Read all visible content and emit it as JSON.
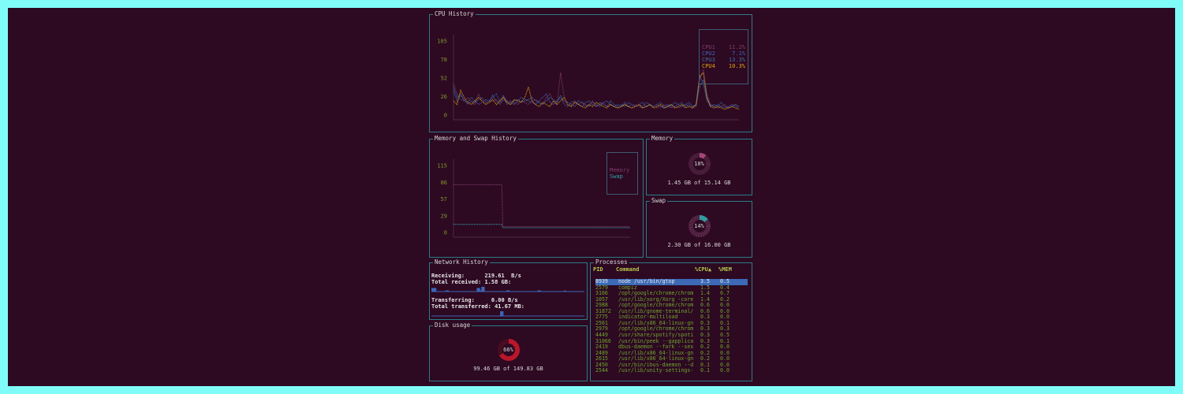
{
  "colors": {
    "background": "#2d0922",
    "border": "#2a7d86",
    "axis_text": "#7f9a2a",
    "cpu1": "#7f3f6e",
    "cpu2": "#3d66b8",
    "cpu3": "#3f6ea0",
    "cpu4": "#e0a40c",
    "memory": "#7f3f6e",
    "swap": "#2fa2a6",
    "disk": "#c0182a",
    "process_text": "#6fa62c",
    "process_header": "#b6c74b",
    "selection": "#3c6ab6"
  },
  "cpu_panel": {
    "title": "CPU History",
    "legend": [
      {
        "label": "CPU1",
        "value": "11.2%"
      },
      {
        "label": "CPU2",
        "value": "7.1%"
      },
      {
        "label": "CPU3",
        "value": "13.3%"
      },
      {
        "label": "CPU4",
        "value": "10.3%"
      }
    ]
  },
  "memswap_panel": {
    "title": "Memory and Swap History",
    "legend": [
      {
        "label": "Memory"
      },
      {
        "label": "Swap"
      }
    ]
  },
  "memory_panel": {
    "title": "Memory",
    "percent_label": "10%",
    "percent": 10,
    "usage": "1.45 GB of 15.14 GB"
  },
  "swap_panel": {
    "title": "Swap",
    "percent_label": "14%",
    "percent": 14,
    "usage": "2.30 GB of 16.00 GB"
  },
  "network_panel": {
    "title": "Network History",
    "receiving_label": "Receiving:",
    "receiving_value": "219.61  B/s",
    "total_received_label": "Total received:",
    "total_received_value": "1.58 GB:",
    "transferring_label": "Transferring:",
    "transferring_value": "0.00 B/s",
    "total_transferred_label": "Total transferred:",
    "total_transferred_value": "41.67 MB:",
    "rx_history": [
      3,
      3,
      3,
      0,
      0,
      0,
      0,
      0,
      0,
      1,
      1,
      0,
      0,
      0,
      0,
      0,
      0,
      0,
      0,
      0,
      0,
      0,
      0,
      0,
      0,
      0,
      0,
      0,
      0,
      3,
      3,
      1,
      4,
      4,
      0,
      0,
      0,
      0,
      0,
      0,
      0,
      0,
      0,
      0,
      0,
      0,
      0,
      0,
      1,
      1,
      0,
      0,
      0,
      0,
      0,
      0,
      0,
      0,
      0,
      0,
      0,
      0,
      0,
      0,
      0,
      0,
      0,
      0,
      1,
      1,
      0,
      0,
      0,
      0,
      0,
      0,
      0,
      0,
      0,
      0,
      0,
      0,
      0,
      0,
      0,
      1,
      0,
      0,
      0,
      0,
      0,
      0,
      0,
      0,
      0,
      0,
      0,
      0
    ],
    "tx_history": [
      0,
      0,
      0,
      0,
      0,
      0,
      0,
      0,
      0,
      0,
      0,
      0,
      0,
      0,
      0,
      0,
      0,
      0,
      0,
      0,
      0,
      0,
      0,
      0,
      0,
      0,
      0,
      0,
      0,
      0,
      0,
      0,
      0,
      0,
      0,
      0,
      0,
      0,
      0,
      0,
      0,
      0,
      0,
      0,
      4,
      4,
      0,
      0,
      0,
      0,
      0,
      0,
      0,
      0,
      0,
      0,
      0,
      0,
      0,
      0,
      0,
      0,
      0,
      0,
      0,
      0,
      0,
      0,
      0,
      0,
      0,
      0,
      0,
      0,
      0,
      0,
      0,
      0,
      0,
      0,
      0,
      0,
      0,
      0,
      0,
      0,
      0,
      0,
      0,
      0,
      0,
      0,
      0,
      0,
      0,
      0,
      0,
      0
    ]
  },
  "disk_panel": {
    "title": "Disk usage",
    "percent_label": "66%",
    "percent": 66,
    "usage": "99.46 GB of 149.83 GB"
  },
  "process_panel": {
    "title": "Processes",
    "headers": {
      "pid": "PID",
      "command": "Command",
      "cpu": "%CPU▲",
      "mem": "%MEM"
    },
    "rows": [
      {
        "pid": "8939",
        "command": "node /usr/bin/gtop",
        "cpu": "3.5",
        "mem": "0.5"
      },
      {
        "pid": "2579",
        "command": "compiz",
        "cpu": "1.5",
        "mem": "0.4"
      },
      {
        "pid": "3166",
        "command": "/opt/google/chrome/chrom",
        "cpu": "1.4",
        "mem": "0.7"
      },
      {
        "pid": "1057",
        "command": "/usr/lib/xorg/Xorg -core",
        "cpu": "1.4",
        "mem": "0.2"
      },
      {
        "pid": "2988",
        "command": "/opt/google/chrome/chrom",
        "cpu": "0.6",
        "mem": "0.0"
      },
      {
        "pid": "31872",
        "command": "/usr/lib/gnome-terminal/",
        "cpu": "0.6",
        "mem": "0.0"
      },
      {
        "pid": "2775",
        "command": "indicator-multiload",
        "cpu": "0.3",
        "mem": "0.0"
      },
      {
        "pid": "2561",
        "command": "/usr/lib/x86_64-linux-gn",
        "cpu": "0.3",
        "mem": "0.1"
      },
      {
        "pid": "2979",
        "command": "/opt/google/chrome/chrom",
        "cpu": "0.3",
        "mem": "0.3"
      },
      {
        "pid": "4449",
        "command": "/usr/share/spotify/spoti",
        "cpu": "0.3",
        "mem": "0.5"
      },
      {
        "pid": "31066",
        "command": "/usr/bin/peek --gapplica",
        "cpu": "0.3",
        "mem": "0.1"
      },
      {
        "pid": "2419",
        "command": "dbus-daemon --fork --ses",
        "cpu": "0.2",
        "mem": "0.0"
      },
      {
        "pid": "2489",
        "command": "/usr/lib/x86_64-linux-gn",
        "cpu": "0.2",
        "mem": "0.0"
      },
      {
        "pid": "2615",
        "command": "/usr/lib/x86_64-linux-gn",
        "cpu": "0.2",
        "mem": "0.0"
      },
      {
        "pid": "2450",
        "command": "/usr/bin/ibus-daemon --d",
        "cpu": "0.1",
        "mem": "0.0"
      },
      {
        "pid": "2544",
        "command": "/usr/lib/unity-settings-",
        "cpu": "0.1",
        "mem": "0.0"
      }
    ]
  },
  "chart_data": [
    {
      "type": "line",
      "ylim": [
        0,
        105
      ],
      "y_ticks": [
        "105",
        "78",
        "52",
        "26",
        "0"
      ],
      "series": [
        {
          "name": "CPU1",
          "values": [
            45,
            30,
            22,
            20,
            25,
            18,
            15,
            30,
            20,
            15,
            18,
            20,
            22,
            18,
            25,
            15,
            20,
            18,
            15,
            20,
            18,
            15,
            20,
            22,
            18,
            15,
            25,
            30,
            20,
            15,
            60,
            25,
            15,
            12,
            20,
            15,
            18,
            12,
            15,
            20,
            12,
            15,
            18,
            12,
            15,
            12,
            10,
            12,
            15,
            12,
            10,
            15,
            12,
            10,
            12,
            15,
            12,
            10,
            12,
            15,
            12,
            10,
            12,
            10,
            12,
            15,
            12,
            10,
            12,
            50,
            65,
            30,
            15,
            12,
            10,
            12,
            15,
            10,
            12,
            15,
            12
          ]
        },
        {
          "name": "CPU2",
          "values": [
            40,
            25,
            30,
            20,
            18,
            25,
            20,
            15,
            18,
            22,
            20,
            25,
            30,
            20,
            28,
            20,
            18,
            15,
            20,
            25,
            22,
            20,
            18,
            15,
            20,
            25,
            30,
            18,
            15,
            20,
            25,
            20,
            18,
            15,
            12,
            20,
            18,
            15,
            12,
            18,
            15,
            12,
            18,
            20,
            15,
            12,
            15,
            12,
            18,
            12,
            15,
            12,
            15,
            12,
            18,
            15,
            12,
            15,
            12,
            10,
            12,
            15,
            12,
            15,
            18,
            12,
            15,
            12,
            15,
            55,
            45,
            20,
            15,
            12,
            15,
            12,
            10,
            12,
            15,
            12,
            10
          ]
        },
        {
          "name": "CPU3",
          "values": [
            35,
            20,
            28,
            22,
            15,
            20,
            18,
            22,
            25,
            18,
            20,
            28,
            20,
            15,
            22,
            18,
            15,
            20,
            22,
            18,
            20,
            22,
            25,
            20,
            18,
            15,
            20,
            25,
            22,
            18,
            28,
            15,
            12,
            18,
            20,
            15,
            12,
            18,
            20,
            15,
            12,
            18,
            15,
            12,
            20,
            15,
            12,
            15,
            12,
            18,
            15,
            12,
            15,
            18,
            12,
            15,
            12,
            15,
            18,
            12,
            15,
            12,
            18,
            15,
            12,
            15,
            18,
            12,
            15,
            40,
            50,
            25,
            12,
            15,
            12,
            18,
            12,
            10,
            12,
            15,
            12
          ]
        },
        {
          "name": "CPU4",
          "values": [
            20,
            15,
            35,
            25,
            18,
            15,
            20,
            25,
            20,
            15,
            18,
            22,
            15,
            20,
            25,
            18,
            15,
            22,
            20,
            18,
            25,
            40,
            20,
            15,
            12,
            18,
            15,
            12,
            20,
            15,
            20,
            25,
            15,
            12,
            18,
            15,
            12,
            10,
            15,
            12,
            18,
            15,
            12,
            10,
            15,
            12,
            10,
            12,
            15,
            12,
            10,
            12,
            15,
            10,
            12,
            15,
            10,
            12,
            15,
            10,
            12,
            15,
            10,
            12,
            15,
            10,
            12,
            10,
            15,
            55,
            60,
            25,
            12,
            10,
            12,
            10,
            8,
            10,
            12,
            10,
            8
          ]
        }
      ]
    },
    {
      "type": "line",
      "ylim": [
        0,
        115
      ],
      "y_ticks": [
        "115",
        "86",
        "57",
        "29",
        "0"
      ],
      "series": [
        {
          "name": "Memory",
          "values": [
            82,
            82,
            82,
            82,
            82,
            82,
            82,
            82,
            82,
            82,
            82,
            82,
            82,
            82,
            82,
            82,
            82,
            82,
            82,
            82,
            82,
            82,
            82,
            82,
            82,
            82,
            82,
            82,
            82,
            82,
            82,
            82,
            82,
            82,
            82,
            82,
            82,
            82,
            82,
            82,
            82,
            82,
            82,
            82,
            82,
            82,
            82,
            82,
            82,
            82,
            10,
            10,
            10,
            10,
            10,
            10,
            10,
            10,
            10,
            10,
            10,
            10,
            10,
            10,
            10,
            10,
            10,
            10,
            10,
            10,
            10,
            10,
            10,
            10,
            10,
            10,
            10,
            10,
            10,
            10,
            10,
            10,
            10,
            10,
            10,
            10,
            10,
            10,
            10,
            10,
            10,
            10,
            10,
            10,
            10,
            10,
            10,
            10,
            10,
            10,
            10,
            10,
            10,
            10,
            10,
            10,
            10,
            10,
            10,
            10,
            10,
            10,
            10,
            10,
            10,
            10,
            10,
            10,
            10,
            10,
            10,
            10,
            10,
            10,
            10,
            10,
            10,
            10,
            10,
            10,
            10,
            10,
            10,
            10,
            10,
            10,
            10,
            10,
            10,
            10,
            10,
            10,
            10,
            10,
            10,
            10,
            10,
            10,
            10,
            10,
            10,
            10,
            10,
            10,
            10,
            10,
            10,
            10,
            10,
            10,
            10,
            10,
            10,
            10,
            10,
            10,
            10,
            10,
            10,
            10,
            10,
            10,
            10,
            10,
            10,
            10,
            10,
            10,
            10,
            10
          ]
        },
        {
          "name": "Swap",
          "values": [
            14,
            14,
            14,
            14,
            14,
            14,
            14,
            14,
            14,
            14,
            14,
            14,
            14,
            14,
            14,
            14,
            14,
            14,
            14,
            14,
            14,
            14,
            14,
            14,
            14,
            14,
            14,
            14,
            14,
            14,
            14,
            14,
            14,
            14,
            14,
            14,
            14,
            14,
            14,
            14,
            14,
            14,
            14,
            14,
            14,
            14,
            14,
            14,
            14,
            14,
            8,
            8,
            8,
            8,
            8,
            8,
            8,
            8,
            8,
            8,
            8,
            8,
            8,
            8,
            8,
            8,
            8,
            8,
            8,
            8,
            8,
            8,
            8,
            8,
            8,
            8,
            8,
            8,
            8,
            8,
            8,
            8,
            8,
            8,
            8,
            8,
            8,
            8,
            8,
            8,
            8,
            8,
            8,
            8,
            8,
            8,
            8,
            8,
            8,
            8,
            8,
            8,
            8,
            8,
            8,
            8,
            8,
            8,
            8,
            8,
            8,
            8,
            8,
            8,
            8,
            8,
            8,
            8,
            8,
            8,
            8,
            8,
            8,
            8,
            8,
            8,
            8,
            8,
            8,
            8,
            8,
            8,
            8,
            8,
            8,
            8,
            8,
            8,
            8,
            8,
            8,
            8,
            8,
            8,
            8,
            8,
            8,
            8,
            8,
            8,
            8,
            8,
            8,
            8,
            8,
            8,
            8,
            8,
            8,
            8,
            8,
            8,
            8,
            8,
            8,
            8,
            8,
            8,
            8,
            8,
            8,
            8,
            8,
            8,
            8,
            8,
            8,
            8,
            8,
            8
          ]
        }
      ]
    }
  ]
}
